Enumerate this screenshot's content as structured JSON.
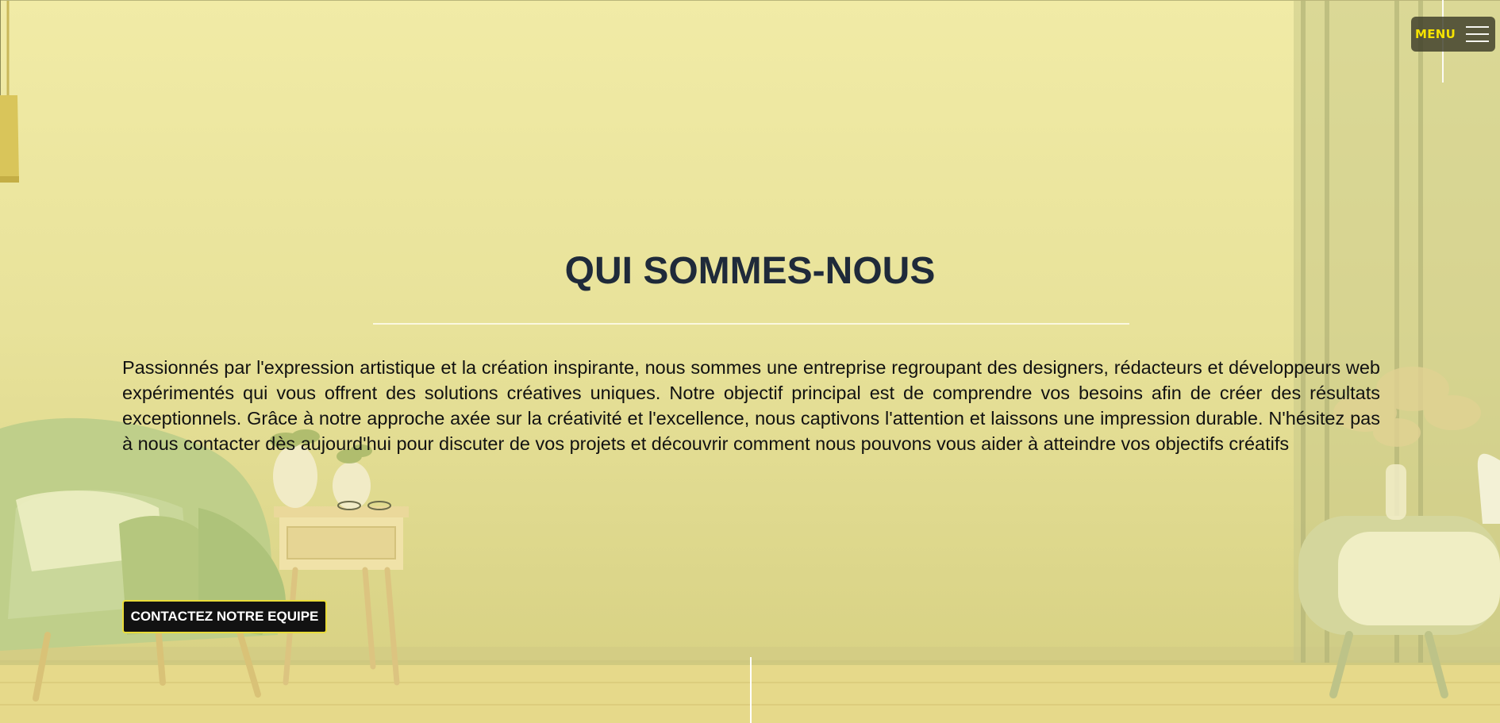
{
  "header": {
    "menu_label": "MENU"
  },
  "about": {
    "title": "QUI SOMMES-NOUS",
    "description": "Passionnés par l'expression artistique et la création inspirante, nous sommes une entreprise regroupant des designers, rédacteurs et développeurs web expérimentés qui vous offrent des solutions créatives uniques. Notre objectif principal est de comprendre vos besoins afin de créer des résultats exceptionnels. Grâce à notre approche axée sur la créativité et l'excellence, nous captivons l'attention et laissons une impression durable. N'hésitez pas à nous contacter dès aujourd'hui pour discuter de vos projets et découvrir comment nous pouvons vous aider à atteindre vos objectifs créatifs",
    "cta_label": "CONTACTEZ NOTRE EQUIPE"
  },
  "colors": {
    "background": "#e8e29a",
    "title": "#1f2a3a",
    "menu_accent": "#f6e300",
    "cta_border": "#e9dc3a"
  },
  "icons": {
    "menu": "hamburger-icon"
  }
}
